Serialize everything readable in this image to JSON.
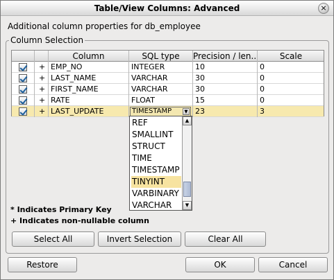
{
  "window": {
    "title": "Table/View Columns: Advanced"
  },
  "subtitle": "Additional column properties for db_employee",
  "group_label": "Column Selection",
  "table": {
    "headers": [
      "",
      "",
      "Column",
      "SQL type",
      "Precision / len...",
      "Scale"
    ],
    "rows": [
      {
        "nullable": "+",
        "column": "EMP_NO",
        "type": "INTEGER",
        "precision": "10",
        "scale": "0"
      },
      {
        "nullable": "+",
        "column": "LAST_NAME",
        "type": "VARCHAR",
        "precision": "30",
        "scale": "0"
      },
      {
        "nullable": "+",
        "column": "FIRST_NAME",
        "type": "VARCHAR",
        "precision": "30",
        "scale": "0"
      },
      {
        "nullable": "+",
        "column": "RATE",
        "type": "FLOAT",
        "precision": "15",
        "scale": "0"
      },
      {
        "nullable": "+",
        "column": "LAST_UPDATE",
        "type": "TIMESTAMP",
        "precision": "23",
        "scale": "3"
      }
    ]
  },
  "dropdown": {
    "items": [
      "REF",
      "SMALLINT",
      "STRUCT",
      "TIME",
      "TIMESTAMP",
      "TINYINT",
      "VARBINARY",
      "VARCHAR"
    ],
    "highlighted": "TINYINT"
  },
  "notes": {
    "primary": "* Indicates Primary Key",
    "nonnull": "+ Indicates non-nullable column"
  },
  "buttons": {
    "select_all": "Select All",
    "invert": "Invert Selection",
    "clear_all": "Clear All",
    "restore": "Restore",
    "ok": "OK",
    "cancel": "Cancel"
  }
}
